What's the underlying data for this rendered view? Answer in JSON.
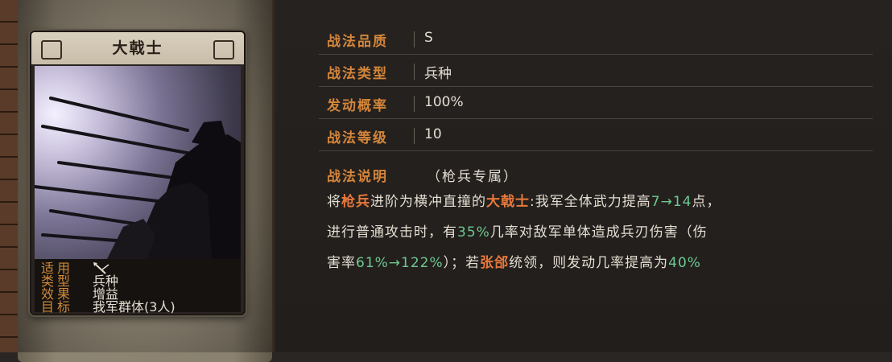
{
  "card": {
    "title": "大戟士",
    "info": [
      {
        "key": "适用",
        "value": ""
      },
      {
        "key": "类型",
        "value": "兵种"
      },
      {
        "key": "效果",
        "value": "增益"
      },
      {
        "key": "目标",
        "value": "我军群体(3人)"
      }
    ],
    "applicable_icon": "crossed-spears-icon"
  },
  "attributes": [
    {
      "key": "战法品质",
      "value": "S"
    },
    {
      "key": "战法类型",
      "value": "兵种"
    },
    {
      "key": "发动概率",
      "value": "100%"
    },
    {
      "key": "战法等级",
      "value": "10"
    }
  ],
  "description": {
    "heading": "战法说明",
    "note": "（枪兵专属）",
    "line1": {
      "p1": "将",
      "h1": "枪兵",
      "p2": "进阶为横冲直撞的",
      "h2": "大戟士",
      "p3": ":我军全体武力提高",
      "n1": "7",
      "a1": "→",
      "n2": "14",
      "p4": "点，"
    },
    "line2": {
      "p1": "进行普通攻击时，有",
      "n1": "35%",
      "p2": "几率对敌军单体造成兵刃伤害（伤"
    },
    "line3": {
      "p1": "害率",
      "n1": "61%",
      "a1": "→",
      "n2": "122%",
      "p2": "）；若",
      "h1": "张郃",
      "p3": "统领，则发动几率提高为",
      "n3": "40%"
    }
  },
  "colors": {
    "label_orange": "#d4853a",
    "highlight_orange": "#e8793b",
    "number_green": "#6fc98f",
    "text_light": "#e4ddd1"
  }
}
